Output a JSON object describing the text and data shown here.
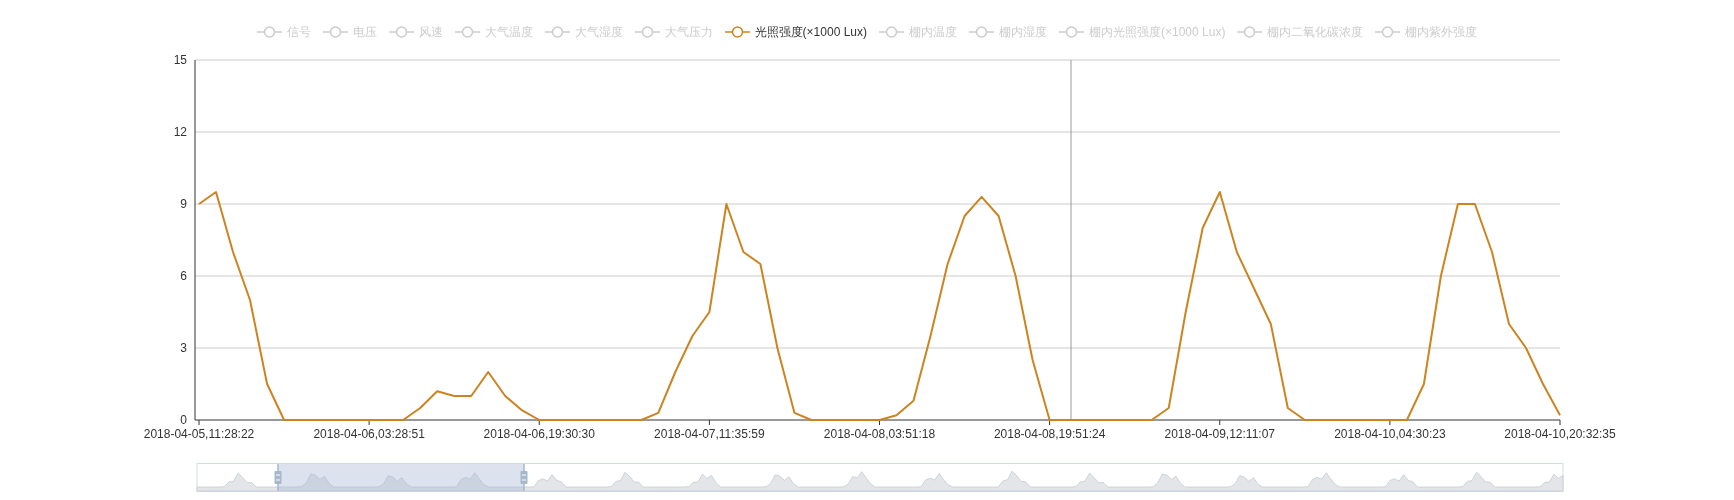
{
  "legend": [
    {
      "label": "信号",
      "selected": false
    },
    {
      "label": "电压",
      "selected": false
    },
    {
      "label": "风速",
      "selected": false
    },
    {
      "label": "大气温度",
      "selected": false
    },
    {
      "label": "大气湿度",
      "selected": false
    },
    {
      "label": "大气压力",
      "selected": false
    },
    {
      "label": "光照强度(×1000 Lux)",
      "selected": true
    },
    {
      "label": "棚内温度",
      "selected": false
    },
    {
      "label": "棚内湿度",
      "selected": false
    },
    {
      "label": "棚内光照强度(×1000 Lux)",
      "selected": false
    },
    {
      "label": "棚内二氧化碳浓度",
      "selected": false
    },
    {
      "label": "棚内紫外强度",
      "selected": false
    }
  ],
  "chart": {
    "chart_data": {
      "type": "line",
      "categories": [
        "2018-04-05,11:28:22",
        null,
        null,
        null,
        null,
        null,
        null,
        null,
        null,
        null,
        "2018-04-06,03:28:51",
        null,
        null,
        null,
        null,
        null,
        null,
        null,
        null,
        null,
        "2018-04-06,19:30:30",
        null,
        null,
        null,
        null,
        null,
        null,
        null,
        null,
        null,
        "2018-04-07,11:35:59",
        null,
        null,
        null,
        null,
        null,
        null,
        null,
        null,
        null,
        "2018-04-08,03:51:18",
        null,
        null,
        null,
        null,
        null,
        null,
        null,
        null,
        null,
        "2018-04-08,19:51:24",
        null,
        null,
        null,
        null,
        null,
        null,
        null,
        null,
        null,
        "2018-04-09,12:11:07",
        null,
        null,
        null,
        null,
        null,
        null,
        null,
        null,
        null,
        "2018-04-10,04:30:23",
        null,
        null,
        null,
        null,
        null,
        null,
        null,
        null,
        null,
        "2018-04-10,20:32:35"
      ],
      "series": [
        {
          "color": "#cc8421",
          "values": [
            9,
            9.5,
            7,
            5,
            1.5,
            0,
            0,
            0,
            0,
            0,
            0,
            0,
            0,
            0.5,
            1.2,
            1,
            1,
            2,
            1,
            0.4,
            0,
            0,
            0,
            0,
            0,
            0,
            0,
            0.3,
            2,
            3.5,
            4.5,
            9,
            7,
            6.5,
            3,
            0.3,
            0,
            0,
            0,
            0,
            0,
            0.2,
            0.8,
            3.5,
            6.5,
            8.5,
            9.3,
            8.5,
            6,
            2.5,
            0,
            0,
            0,
            0,
            0,
            0,
            0,
            0.5,
            4.5,
            8,
            9.5,
            7,
            5.5,
            4,
            0.5,
            0,
            0,
            0,
            0,
            0,
            0,
            0,
            1.5,
            6,
            9,
            9,
            7,
            4,
            3,
            1.5,
            0.2
          ]
        }
      ],
      "ylim": [
        0,
        15
      ],
      "grid": true,
      "yticks": [
        0,
        3,
        6,
        9,
        12,
        15
      ]
    }
  }
}
